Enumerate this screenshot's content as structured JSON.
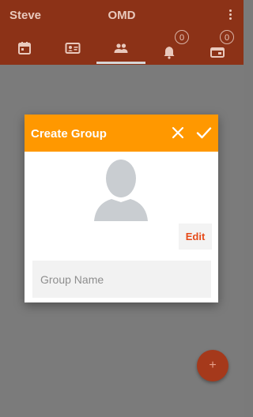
{
  "appbar": {
    "user_name": "Steve",
    "title": "OMD",
    "tabs": [
      {
        "icon": "calendar-icon"
      },
      {
        "icon": "contact-card-icon"
      },
      {
        "icon": "group-icon",
        "selected": true
      },
      {
        "icon": "bell-icon",
        "badge": "0"
      },
      {
        "icon": "message-card-icon",
        "badge": "0"
      }
    ]
  },
  "dialog": {
    "title": "Create Group",
    "edit_label": "Edit",
    "group_name_placeholder": "Group Name"
  },
  "fab": {
    "label": "+"
  },
  "colors": {
    "appbar": "#8c3217",
    "dialog_header": "#ff9800",
    "accent": "#e64a19",
    "fab": "#a5391b"
  }
}
